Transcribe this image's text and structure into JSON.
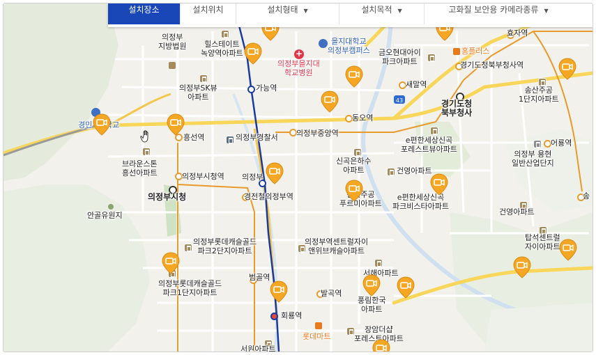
{
  "colors": {
    "land": "#f3f1ec",
    "hill": "#e3ebd9",
    "subway_line": "#1a3aa0",
    "rail_line": "#e89a2a",
    "main_road": "#f7d65a",
    "poi_brown": "#a78a5c",
    "cctv_pin": "#f5a623",
    "nav_active": "#1a47b8"
  },
  "nav": {
    "tabs": [
      {
        "label": "설치장소"
      },
      {
        "label": "설치위치"
      },
      {
        "label": "설치형태"
      },
      {
        "label": "설치목적"
      },
      {
        "label": "고화질 보안용 카메라종류"
      }
    ]
  },
  "map": {
    "labels": {
      "지방법원": "의정부\n지방법원",
      "힐스테이트": "힐스테이트\n녹양역아파트",
      "을지대": "을지대학교\n의정부캠퍼스",
      "을지대병원": "의정부을지대\n학교병원",
      "금오현대": "금오현대아이\n파크아파트",
      "홈플러스": "홈플러스",
      "효자역": "효자역",
      "경기도청북부청사역": "경기도청북부청사역",
      "송산주공": "송산주공\n1단지아파트",
      "가능역": "가능역",
      "sk뷰": "의정부SK뷰\n아파트",
      "새말역": "새말역",
      "경기도청북부청사": "경기도청\n북부청사",
      "동오역": "동오역",
      "경민": "경민",
      "학교": "학교",
      "흥선역": "흥선역",
      "경찰서": "의정부경찰서",
      "중앙역": "의정부중앙역",
      "e편한세상신곡포레": "e편한세상신곡\n포레스트뷰아파트",
      "어룡역": "어룡역",
      "브라운스톤": "브라운스톤\n흥선아파트",
      "신곡은하수": "신곡은하수\n아파트",
      "용현산업": "의정부 용현\n일반산업단지",
      "건영아파트1": "건영아파트",
      "시청역": "의정부시청역",
      "의정부역": "의정부",
      "의정부시청": "의정부시청",
      "경전철의정부역": "경전철의정부역",
      "신곡주공": "신곡주공\n푸르미아파트",
      "e편한세상신곡파크": "e편한세상신곡\n파크비스타아파트",
      "송산": "송",
      "안골유원지": "안골유원지",
      "건영아파트2": "건영아파트",
      "롯데캐슬2": "의정부롯데캐슬골드\n파크2단지아파트",
      "센트럴자이": "의정부역센트럴자이\n앤위브캐슬아파트",
      "탑석센트럴": "탑석센트럴\n자이아파트",
      "롯데캐슬1": "의정부롯데캐슬골드\n파크1단지아파트",
      "범골역": "범골역",
      "서해아파트": "서해아파트",
      "발곡역": "발곡역",
      "풍림한국": "풍림한국\n아파트",
      "회룡역": "회룡역",
      "장암더샵": "장암더샵\n포레스트아파트",
      "롯데마트": "롯데마트",
      "서원아파트": "서원아파트",
      "route43": "43"
    }
  }
}
